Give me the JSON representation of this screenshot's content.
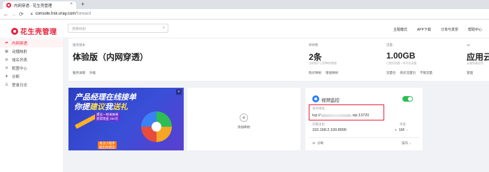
{
  "browser": {
    "tab_title": "内网穿透 - 花生壳管理",
    "tab_close": "×",
    "new_tab": "+",
    "back": "←",
    "forward": "→",
    "reload": "⟳",
    "url_host": "console.hsk.oray.com",
    "url_path": "/forward"
  },
  "header": {
    "logo_text": "花生壳管理",
    "search_placeholder": "搜索映射",
    "nav": [
      "主题模式",
      "APP下载",
      "订单与发票",
      "帮助中心"
    ]
  },
  "sidebar": {
    "items": [
      {
        "label": "内网穿透",
        "icon": "⇄",
        "active": true
      },
      {
        "label": "动播映射",
        "icon": "▦",
        "active": false
      },
      {
        "label": "域名列表",
        "icon": "⊞",
        "active": false
      },
      {
        "label": "配置中心",
        "icon": "⚙",
        "active": false
      },
      {
        "label": "诊断",
        "icon": "✚",
        "active": false
      },
      {
        "label": "登录日志",
        "icon": "☰",
        "active": false
      }
    ]
  },
  "stats": {
    "service": {
      "label": "服务版本",
      "value": "体验版（内网穿透）",
      "links": [
        "服务详情",
        "升级"
      ]
    },
    "mappings": {
      "label": "映射数",
      "value": "2条",
      "sub": "当前账户已用映射数量",
      "links": [
        "购买映射",
        "增值映射"
      ]
    },
    "traffic": {
      "label": "流量",
      "value": "1.00GB",
      "sub": "已使用流量 / 本月总流量",
      "links": [
        "流量包",
        "购买流量包",
        "不限流量"
      ]
    },
    "cloud": {
      "label": "vp",
      "value": "应用云",
      "sub": "云服务器应用",
      "links": [
        "管理"
      ]
    }
  },
  "ad": {
    "line1": "产品经理在线接单",
    "line2_a": "你提",
    "line2_b": "建议",
    "line2_c": "我",
    "line2_d": "送礼",
    "tag1": "建议一经采纳将",
    "tag2": "获得现金 200元",
    "footer1": "关注小程序",
    "footer2": "提出你建议",
    "close": "×"
  },
  "add_card": {
    "icon": "+",
    "label": "添加映射"
  },
  "mapping_card": {
    "title": "视频监控",
    "enabled": true,
    "addr_label": "访问地址",
    "addr_prefix": "tcp://",
    "addr_suffix": ".vip:13720",
    "host_label": "内网主机",
    "host_value": "192.168.2.100:8000",
    "bw_label": "带宽",
    "bw_value": "1M",
    "bw_arrow": "›",
    "diag_label": "诊断",
    "op_label": "操作 ⌄",
    "colors": {
      "accent": "#e6213a",
      "toggle_on": "#2ebd55",
      "icon": "#2d7ff9"
    }
  }
}
